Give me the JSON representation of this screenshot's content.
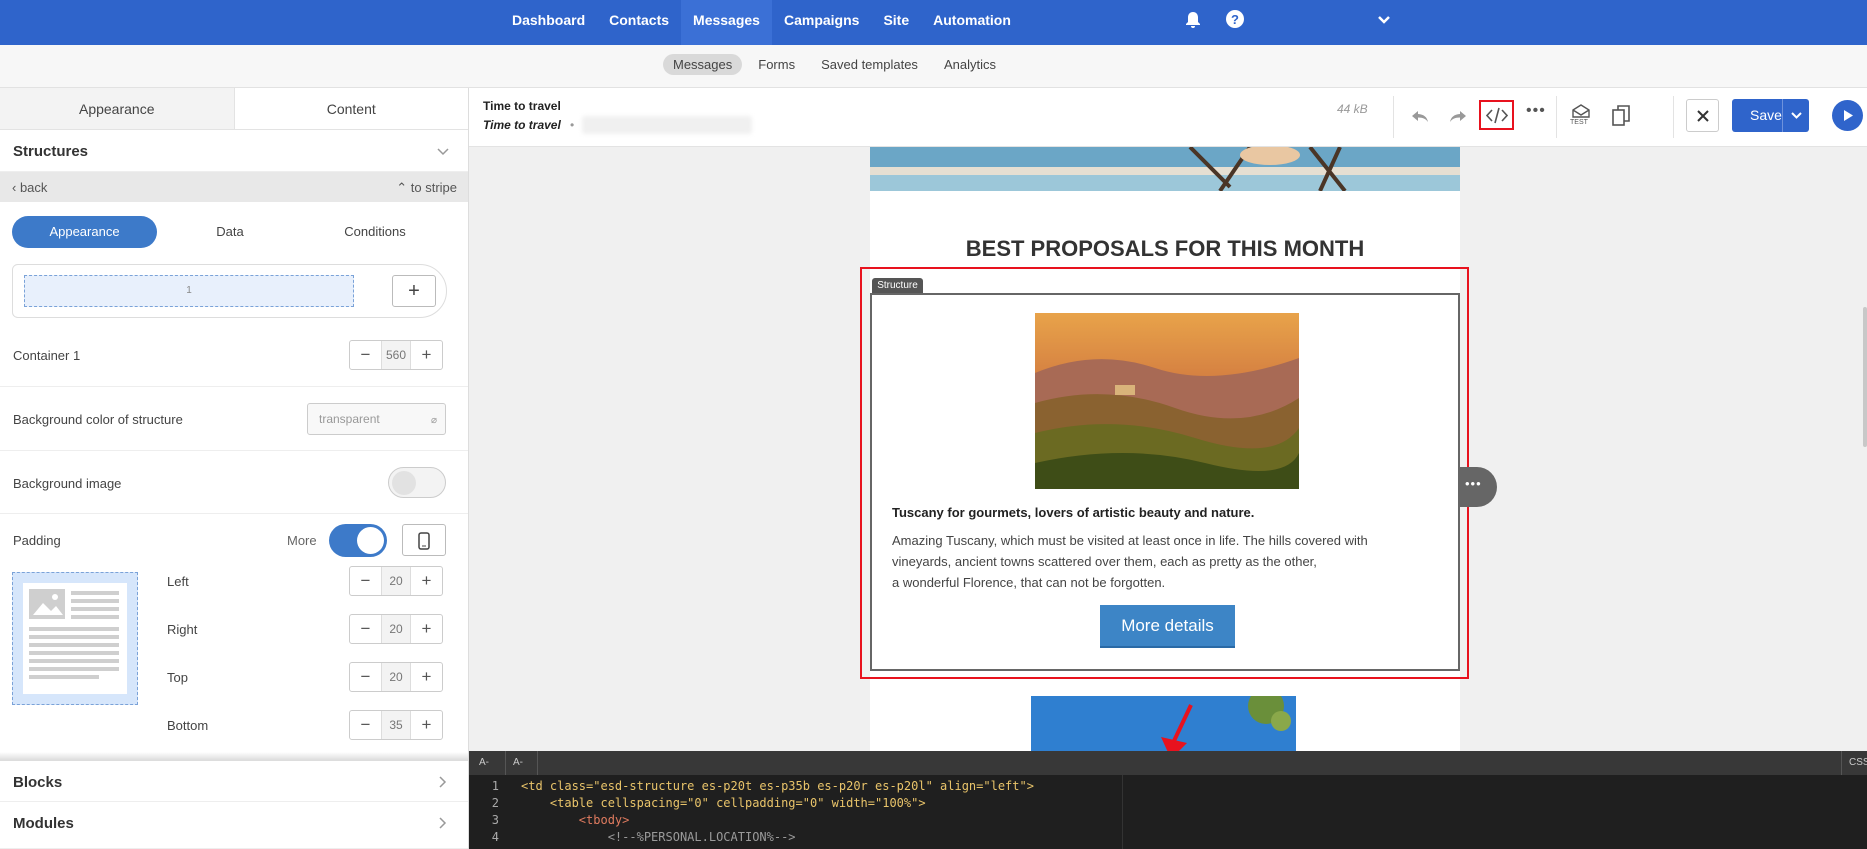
{
  "topnav": {
    "items": [
      "Dashboard",
      "Contacts",
      "Messages",
      "Campaigns",
      "Site",
      "Automation"
    ],
    "active": "Messages"
  },
  "subnav": {
    "items": [
      "Messages",
      "Forms",
      "Saved templates",
      "Analytics"
    ]
  },
  "panel": {
    "tabs": [
      "Appearance",
      "Content"
    ],
    "structures_title": "Structures",
    "back": "back",
    "to_stripe": "to stripe",
    "subtabs": [
      "Appearance",
      "Data",
      "Conditions"
    ],
    "container_index": "1",
    "container_label": "Container 1",
    "container_value": "560",
    "bg_color_label": "Background color of structure",
    "bg_color_value": "transparent",
    "bg_image_label": "Background image",
    "padding_label": "Padding",
    "more_label": "More",
    "padding": [
      {
        "label": "Left",
        "value": "20"
      },
      {
        "label": "Right",
        "value": "20"
      },
      {
        "label": "Top",
        "value": "20"
      },
      {
        "label": "Bottom",
        "value": "35"
      }
    ],
    "blocks": "Blocks",
    "modules": "Modules"
  },
  "editor": {
    "name": "Time to travel",
    "subject": "Time to travel",
    "size": "44 kB",
    "save": "Save",
    "test": "TEST"
  },
  "email": {
    "heading": "BEST PROPOSALS FOR THIS MONTH",
    "structure_badge": "Structure",
    "card_title": "Tuscany for gourmets, lovers of artistic beauty and nature.",
    "card_line1": "Amazing Tuscany, which must be visited at least once in life. The hills covered with",
    "card_line2": "vineyards, ancient towns scattered over them, each as pretty as the other,",
    "card_line3": "a wonderful Florence, that can not be forgotten.",
    "button": "More details"
  },
  "codebar": {
    "a1": "A-",
    "a2": "A-",
    "css": "CSS"
  },
  "code": {
    "lines": [
      "1",
      "2",
      "3",
      "4"
    ],
    "line1": "<td class=\"esd-structure es-p20t es-p35b es-p20r es-p20l\" align=\"left\">",
    "line2": "    <table cellspacing=\"0\" cellpadding=\"0\" width=\"100%\">",
    "line3": "        <tbody>",
    "line4": "            <!--%PERSONAL.LOCATION%-->"
  },
  "colors": {
    "brand": "#2f64cb",
    "highlight": "#e8121e",
    "button": "#3d85c6"
  }
}
